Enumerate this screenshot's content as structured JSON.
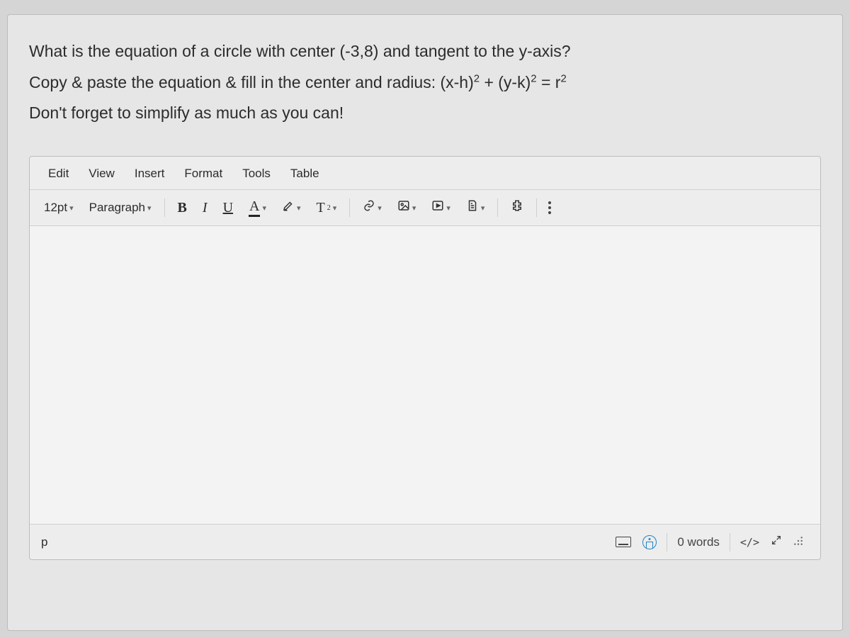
{
  "prompt": {
    "line1_a": "What is the equation of a circle with center (-3,8) and tangent to the y-axis?",
    "line2_a": "Copy & paste the equation & fill in the center and radius: (x-h)",
    "line2_b": " + (y-k)",
    "line2_c": " = r",
    "sup": "2",
    "line3": "Don't forget to simplify as much as you can!"
  },
  "menubar": {
    "edit": "Edit",
    "view": "View",
    "insert": "Insert",
    "format": "Format",
    "tools": "Tools",
    "table": "Table"
  },
  "toolbar": {
    "font_size": "12pt",
    "block": "Paragraph",
    "bold": "B",
    "italic": "I",
    "underline": "U",
    "textcolor": "A",
    "super_label": "T",
    "super_exp": "2"
  },
  "statusbar": {
    "path": "p",
    "wordcount": "0 words",
    "code": "</>"
  }
}
